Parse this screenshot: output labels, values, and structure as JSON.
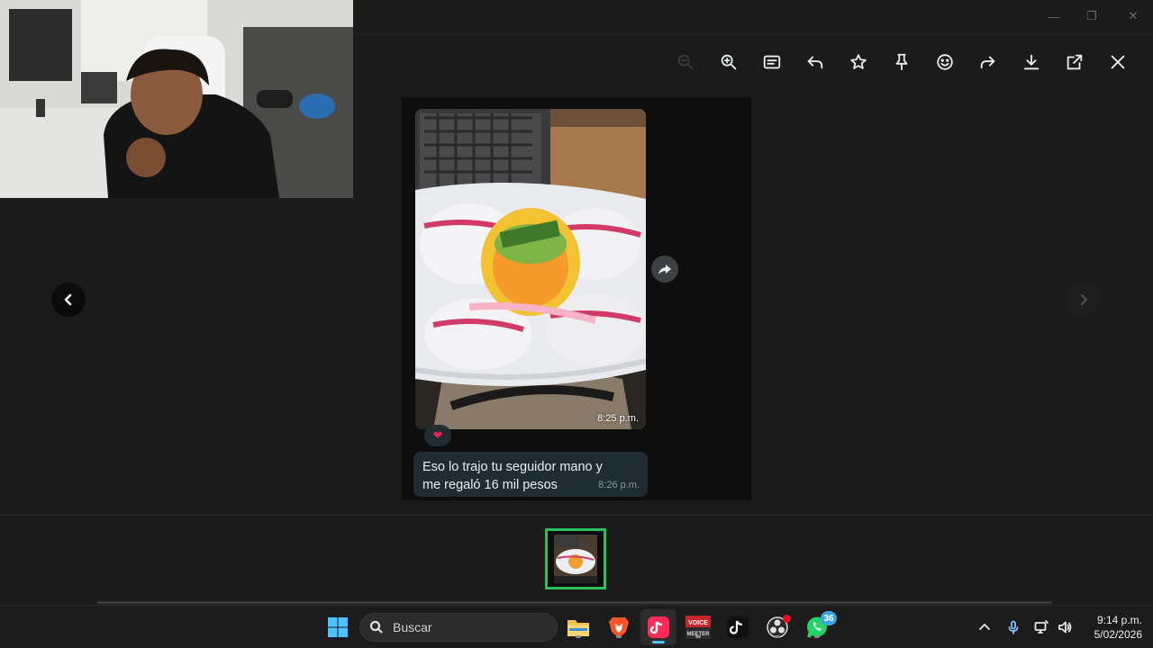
{
  "window": {
    "controls": {
      "minimize": "—",
      "maximize": "❐",
      "close": "✕"
    }
  },
  "toolbar": {
    "icons": [
      "zoom-out-icon",
      "zoom-in-icon",
      "captions-icon",
      "reply-icon",
      "star-icon",
      "pin-icon",
      "emoji-icon",
      "forward-icon",
      "download-icon",
      "open-external-icon",
      "close-icon"
    ]
  },
  "viewer": {
    "media_message": {
      "time": "8:25 p.m.",
      "reaction": "❤"
    },
    "text_message": {
      "text": "Eso lo trajo tu seguidor mano y me regaló 16 mil pesos",
      "time": "8:26 p.m."
    }
  },
  "taskbar": {
    "search_label": "Buscar",
    "voicemeeter_label_top": "VOICE",
    "voicemeeter_label_bottom": "MEETER",
    "whatsapp_badge": "36",
    "clock_time": "9:14 p.m.",
    "clock_date": "5/02/2026"
  },
  "colors": {
    "accent_green": "#2fbe5c",
    "bubble_bg": "#202c33",
    "taskbar_bg": "#1c1c1c"
  }
}
